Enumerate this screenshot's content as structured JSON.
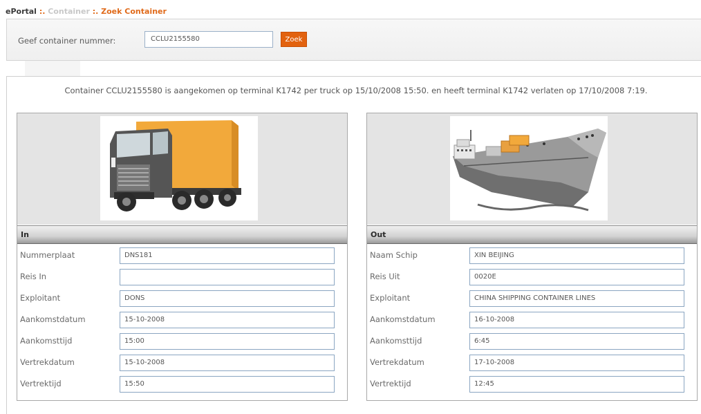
{
  "breadcrumb": {
    "home": "ePortal",
    "separator": ":.",
    "middle": "Container",
    "current": "Zoek Container"
  },
  "search": {
    "label": "Geef container nummer:",
    "value": "CCLU2155580",
    "button_label": "Zoek"
  },
  "message": "Container CCLU2155580 is aangekomen op terminal K1742 per truck op 15/10/2008 15:50. en heeft terminal K1742 verlaten op 17/10/2008 7:19.",
  "in_panel": {
    "title": "In",
    "image_icon": "truck-icon",
    "rows": [
      {
        "label": "Nummerplaat",
        "value": "DNS181"
      },
      {
        "label": "Reis In",
        "value": ""
      },
      {
        "label": "Exploitant",
        "value": "DONS"
      },
      {
        "label": "Aankomstdatum",
        "value": "15-10-2008"
      },
      {
        "label": "Aankomsttijd",
        "value": "15:00"
      },
      {
        "label": "Vertrekdatum",
        "value": "15-10-2008"
      },
      {
        "label": "Vertrektijd",
        "value": "15:50"
      }
    ]
  },
  "out_panel": {
    "title": "Out",
    "image_icon": "ship-icon",
    "rows": [
      {
        "label": "Naam Schip",
        "value": "XIN BEIJING"
      },
      {
        "label": "Reis Uit",
        "value": "0020E"
      },
      {
        "label": "Exploitant",
        "value": "CHINA SHIPPING CONTAINER LINES"
      },
      {
        "label": "Aankomstdatum",
        "value": "16-10-2008"
      },
      {
        "label": "Aankomsttijd",
        "value": "6:45"
      },
      {
        "label": "Vertrekdatum",
        "value": "17-10-2008"
      },
      {
        "label": "Vertrektijd",
        "value": "12:45"
      }
    ]
  },
  "colors": {
    "accent": "#e2620f",
    "field_border": "#8aa5c1",
    "truck_cargo": "#f2a93b",
    "ship_hull": "#9a9a9a"
  }
}
